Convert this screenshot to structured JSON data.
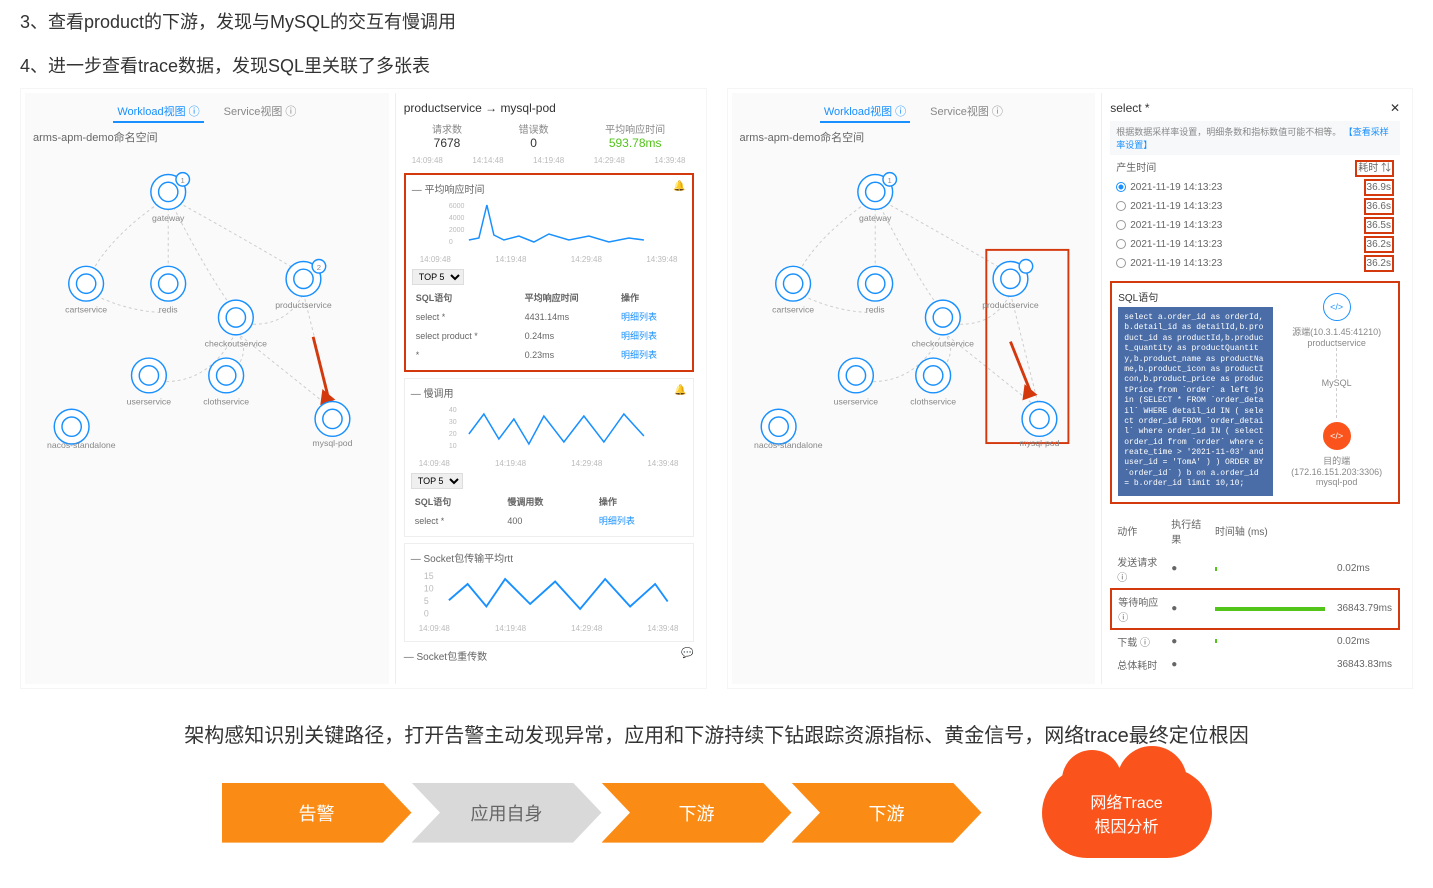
{
  "titles": {
    "t3": "3、查看product的下游，发现与MySQL的交互有慢调用",
    "t4": "4、进一步查看trace数据，发现SQL里关联了多张表"
  },
  "tabs": {
    "workload": "Workload视图",
    "service": "Service视图"
  },
  "namespace": "arms-apm-demo命名空间",
  "nodes": [
    "gateway",
    "cartservice",
    "redis",
    "productservice",
    "checkoutservice",
    "userservice",
    "clothservice",
    "mysql-pod",
    "nacos-standalone"
  ],
  "sidepanel": {
    "title": "productservice → mysql-pod",
    "stats": {
      "req_label": "请求数",
      "req": "7678",
      "err_label": "错误数",
      "err": "0",
      "rt_label": "平均响应时间",
      "rt": "593.78ms"
    },
    "ticks": [
      "14:09:48",
      "14:14:48",
      "14:19:48",
      "14:29:48",
      "14:39:48"
    ],
    "avg_rt": {
      "title": "— 平均响应时间",
      "ytop": "6000",
      "y2": "4000",
      "y3": "2000",
      "y4": "0",
      "top5": "TOP 5",
      "cols": [
        "SQL语句",
        "平均响应时间",
        "操作"
      ],
      "rows": [
        {
          "sql": "select *",
          "ms": "4431.14ms",
          "op": "明细列表"
        },
        {
          "sql": "select product *",
          "ms": "0.24ms",
          "op": "明细列表"
        },
        {
          "sql": "*",
          "ms": "0.23ms",
          "op": "明细列表"
        }
      ]
    },
    "slow": {
      "title": "— 慢调用",
      "ytop": "40",
      "y2": "30",
      "y3": "20",
      "y4": "10",
      "cols": [
        "SQL语句",
        "慢调用数",
        "操作"
      ],
      "rows": [
        {
          "sql": "select *",
          "n": "400",
          "op": "明细列表"
        }
      ]
    },
    "socket_rtt": "— Socket包传输平均rtt",
    "socket_retrans": "— Socket包重传数"
  },
  "trace": {
    "head": "select *",
    "note_pre": "根据数据采样率设置，明细条数和指标数值可能不相等。",
    "note_link": "【查看采样率设置】",
    "cols": {
      "time": "产生时间",
      "cost": "耗时"
    },
    "rows": [
      {
        "t": "2021-11-19 14:13:23",
        "ms": "36.9s",
        "sel": true
      },
      {
        "t": "2021-11-19 14:13:23",
        "ms": "36.6s"
      },
      {
        "t": "2021-11-19 14:13:23",
        "ms": "36.5s"
      },
      {
        "t": "2021-11-19 14:13:23",
        "ms": "36.2s"
      },
      {
        "t": "2021-11-19 14:13:23",
        "ms": "36.2s"
      }
    ],
    "sql_label": "SQL语句",
    "sql": "select a.order_id as orderId,b.detail_id as detailId,b.product_id as productId,b.product_quantity as productQuantity,b.product_name as productName,b.product_icon as productIcon,b.product_price as productPrice from `order` a left join (SELECT * FROM `order_detail` WHERE detail_id IN ( select order_id FROM `order_detail` where order_id IN ( select order_id from `order` where create_time > '2021-11-03' and user_id = 'TomA' ) ) ORDER BY `order_id` ) b on a.order_id = b.order_id limit 10,10;",
    "src_label": "源端(10.3.1.45:41210)",
    "src": "productservice",
    "mid": "MySQL",
    "dst_label": "目的端(172.16.151.203:3306)",
    "dst": "mysql-pod",
    "metrics_cols": [
      "动作",
      "执行结果",
      "时间轴 (ms)"
    ],
    "metrics": [
      {
        "k": "发送请求 ⓘ",
        "bar": 1,
        "v": "0.02ms"
      },
      {
        "k": "等待响应 ⓘ",
        "bar": 90,
        "v": "36843.79ms",
        "hl": true
      },
      {
        "k": "下载 ⓘ",
        "bar": 1,
        "v": "0.02ms"
      },
      {
        "k": "总体耗时",
        "bar": 0,
        "v": "36843.83ms"
      }
    ]
  },
  "summary": "架构感知识别关键路径，打开告警主动发现异常，应用和下游持续下钻跟踪资源指标、黄金信号，网络trace最终定位根因",
  "flow": [
    "告警",
    "应用自身",
    "下游",
    "下游"
  ],
  "cloud": {
    "l1": "网络Trace",
    "l2": "根因分析"
  }
}
